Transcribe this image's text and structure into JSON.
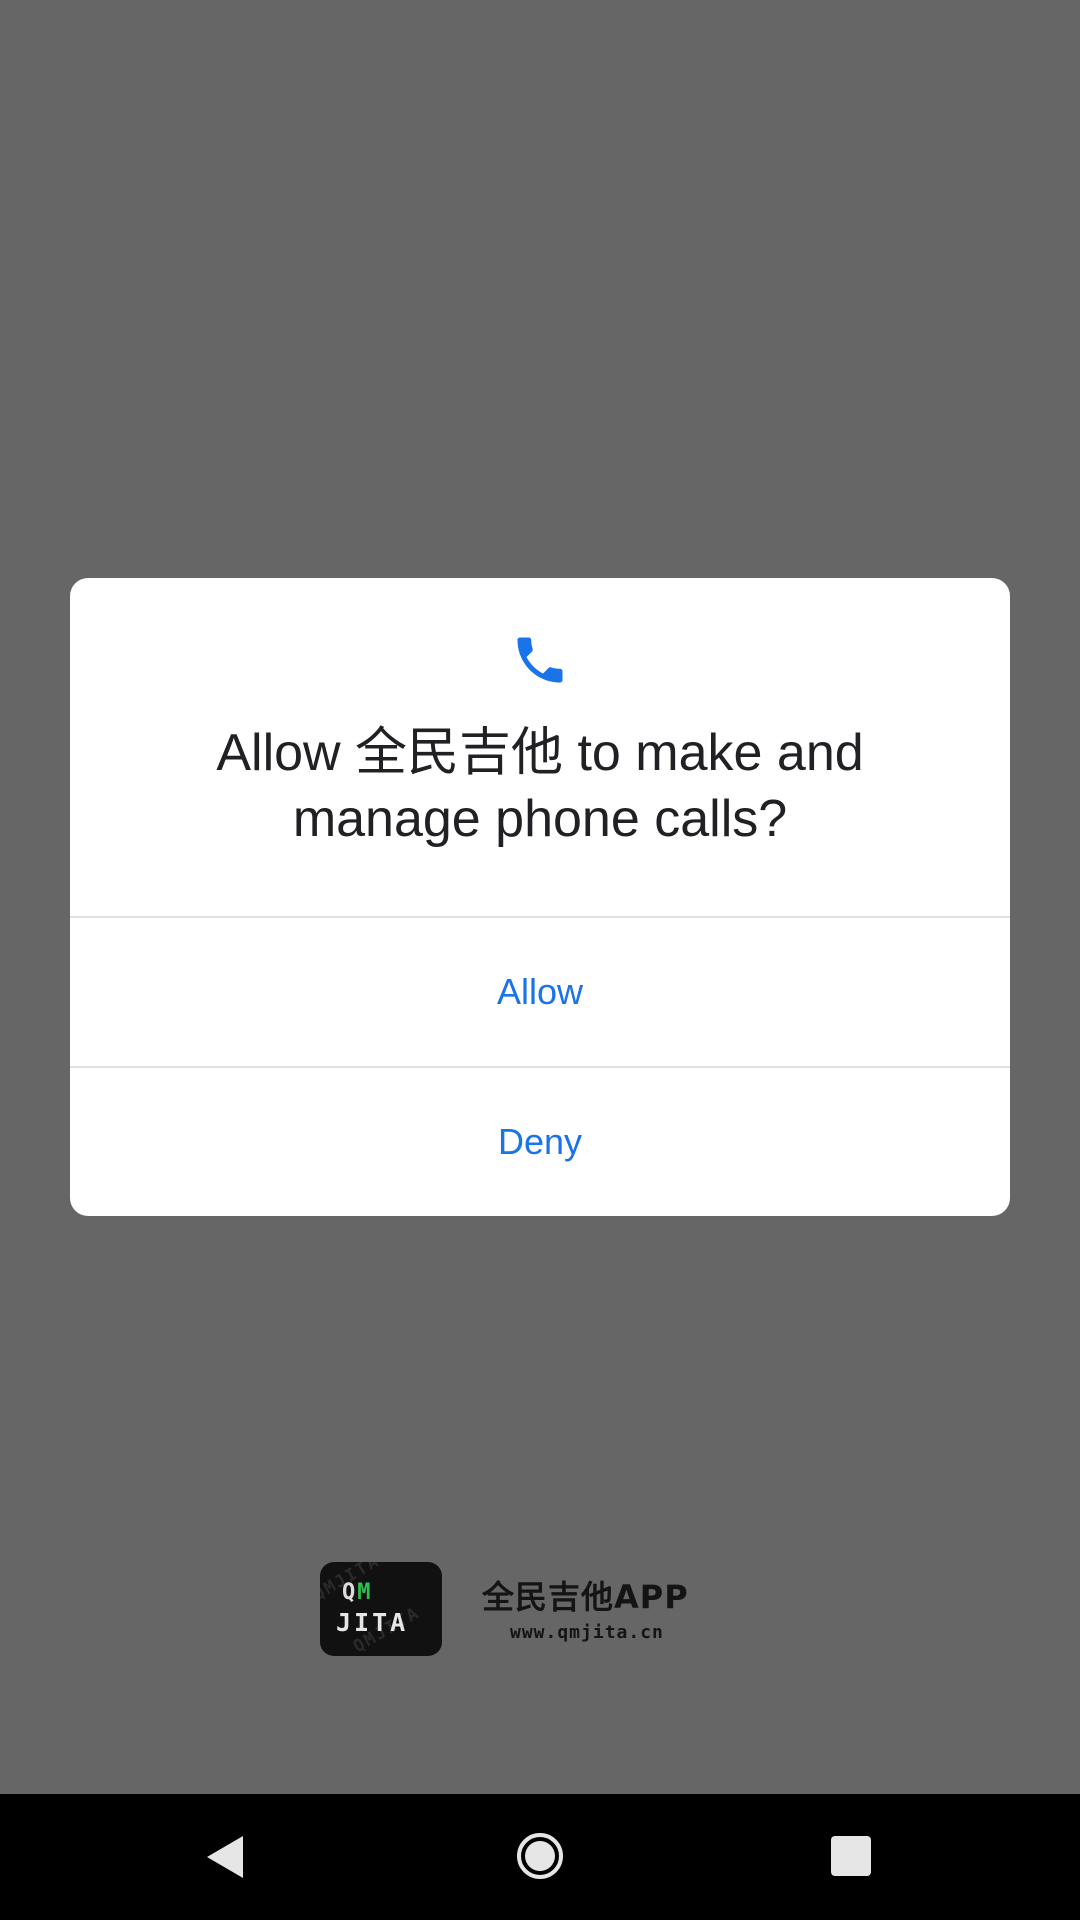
{
  "background_app": {
    "brand_name": "全民吉他APP",
    "brand_url": "www.qmjita.cn",
    "logo": {
      "line1_q": "Q",
      "line1_m": "M",
      "line2": "JITA",
      "watermark": "QMJITA"
    }
  },
  "permission_dialog": {
    "icon": "phone-icon",
    "title": "Allow 全民吉他 to make and manage phone calls?",
    "allow_label": "Allow",
    "deny_label": "Deny",
    "accent_color": "#1a73e8"
  },
  "navbar": {
    "back_icon": "back-triangle-icon",
    "home_icon": "home-circle-icon",
    "recents_icon": "recents-square-icon"
  }
}
